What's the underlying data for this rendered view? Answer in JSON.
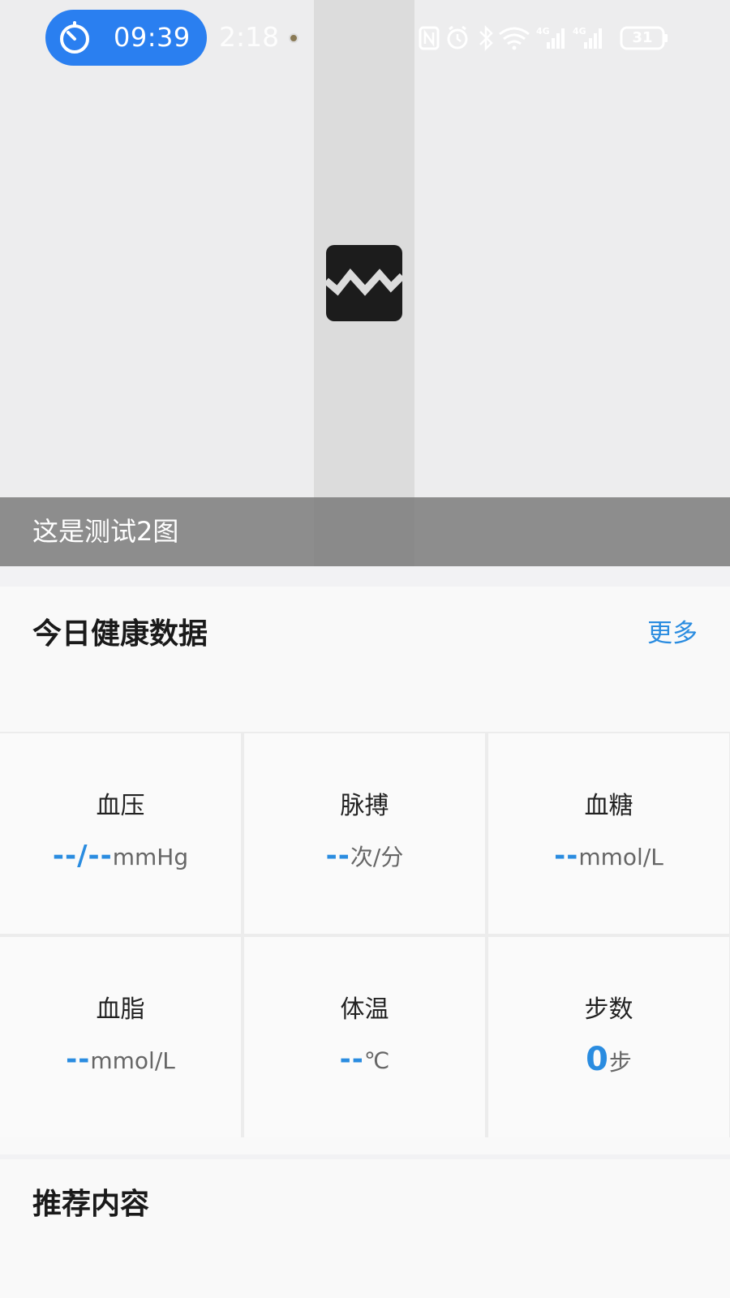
{
  "status_bar": {
    "timer": "09:39",
    "clock": "2:18",
    "battery": "31",
    "icons": [
      "timer-icon",
      "nfc-icon",
      "alarm-icon",
      "bluetooth-icon",
      "wifi-icon",
      "signal-4g-icon",
      "signal-5g-icon",
      "battery-icon"
    ]
  },
  "banner": {
    "caption": "这是测试2图",
    "image_icon": "broken-image-icon"
  },
  "health": {
    "title": "今日健康数据",
    "more": "更多",
    "metrics": [
      {
        "label": "血压",
        "value": "--/--",
        "unit": "mmHg"
      },
      {
        "label": "脉搏",
        "value": "--",
        "unit": "次/分"
      },
      {
        "label": "血糖",
        "value": "--",
        "unit": "mmol/L"
      },
      {
        "label": "血脂",
        "value": "--",
        "unit": "mmol/L"
      },
      {
        "label": "体温",
        "value": "--",
        "unit": "℃"
      },
      {
        "label": "步数",
        "value": "0",
        "unit": "步"
      }
    ]
  },
  "recommend": {
    "title": "推荐内容"
  },
  "colors": {
    "accent": "#2a8ce0",
    "timer_pill": "#2a7ff0"
  }
}
